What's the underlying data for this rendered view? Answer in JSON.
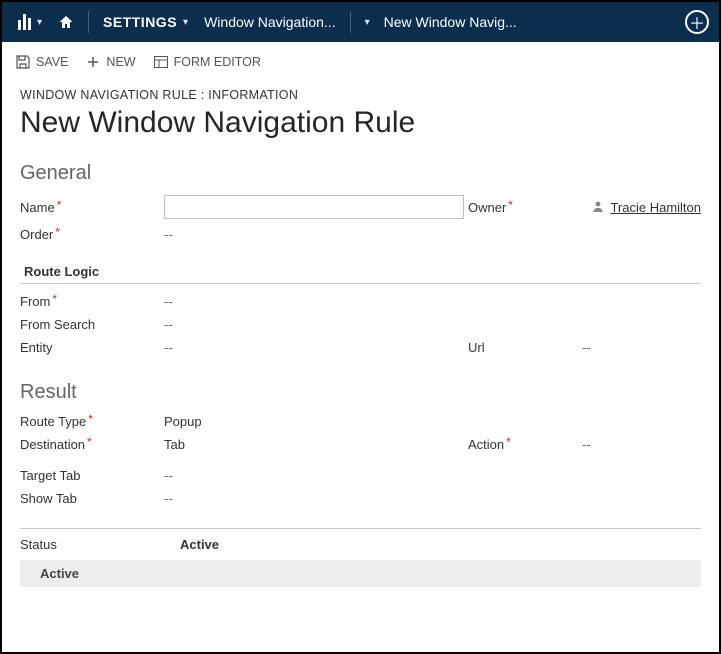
{
  "topbar": {
    "settings_label": "SETTINGS",
    "breadcrumb1": "Window Navigation...",
    "breadcrumb2": "New Window Navig..."
  },
  "cmdbar": {
    "save": "SAVE",
    "new": "NEW",
    "form_editor": "FORM EDITOR"
  },
  "header": {
    "crumb": "WINDOW NAVIGATION RULE : INFORMATION",
    "title": "New Window Navigation Rule"
  },
  "sections": {
    "general": "General",
    "route_logic": "Route Logic",
    "result": "Result"
  },
  "fields": {
    "name_label": "Name",
    "name_value": "",
    "owner_label": "Owner",
    "owner_value": "Tracie Hamilton",
    "order_label": "Order",
    "order_value": "--",
    "from_label": "From",
    "from_value": "--",
    "from_search_label": "From Search",
    "from_search_value": "--",
    "entity_label": "Entity",
    "entity_value": "--",
    "url_label": "Url",
    "url_value": "--",
    "route_type_label": "Route Type",
    "route_type_value": "Popup",
    "destination_label": "Destination",
    "destination_value": "Tab",
    "action_label": "Action",
    "action_value": "--",
    "target_tab_label": "Target Tab",
    "target_tab_value": "--",
    "show_tab_label": "Show Tab",
    "show_tab_value": "--"
  },
  "status": {
    "label": "Status",
    "value": "Active",
    "sub": "Active"
  }
}
